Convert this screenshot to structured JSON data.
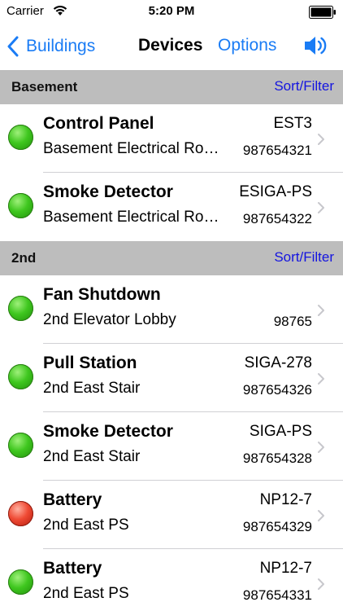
{
  "status_bar": {
    "carrier": "Carrier",
    "time": "5:20 PM",
    "icons": [
      "wifi-icon",
      "battery-icon"
    ]
  },
  "nav": {
    "back_label": "Buildings",
    "title": "Devices",
    "options_label": "Options",
    "speaker_icon": "speaker-icon",
    "accent_color": "#1a7cf5"
  },
  "sections": [
    {
      "title": "Basement",
      "sort_label": "Sort/Filter",
      "rows": [
        {
          "name": "Control Panel",
          "location": "Basement Electrical Ro…",
          "model": "EST3",
          "serial": "987654321",
          "status": "green"
        },
        {
          "name": "Smoke Detector",
          "location": "Basement Electrical Ro…",
          "model": "ESIGA-PS",
          "serial": "987654322",
          "status": "green"
        }
      ]
    },
    {
      "title": "2nd",
      "sort_label": "Sort/Filter",
      "rows": [
        {
          "name": "Fan Shutdown",
          "location": "2nd Elevator Lobby",
          "model": "",
          "serial": "98765",
          "status": "green"
        },
        {
          "name": "Pull Station",
          "location": "2nd East Stair",
          "model": "SIGA-278",
          "serial": "987654326",
          "status": "green"
        },
        {
          "name": "Smoke Detector",
          "location": "2nd East Stair",
          "model": "SIGA-PS",
          "serial": "987654328",
          "status": "green"
        },
        {
          "name": "Battery",
          "location": "2nd East PS",
          "model": "NP12-7",
          "serial": "987654329",
          "status": "red"
        },
        {
          "name": "Battery",
          "location": "2nd East PS",
          "model": "NP12-7",
          "serial": "987654331",
          "status": "green"
        }
      ]
    }
  ],
  "status_colors": {
    "green": "#3fc71f",
    "red": "#ef4a34"
  },
  "section_header_color": "#bdbdbd",
  "sort_filter_color": "#1414e0"
}
